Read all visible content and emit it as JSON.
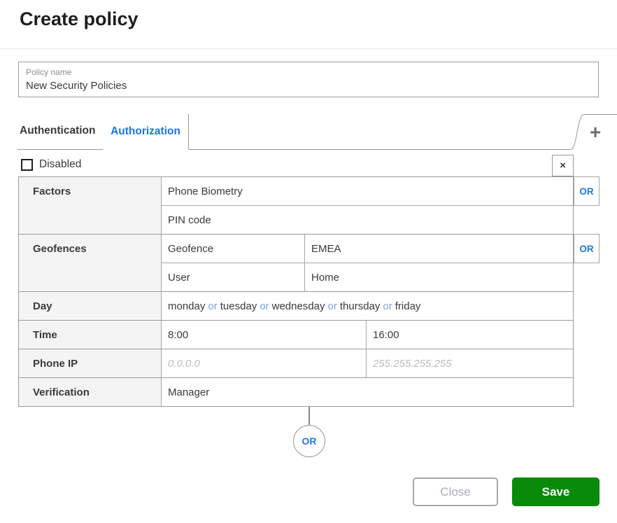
{
  "window": {
    "title": "Create policy"
  },
  "policy_name": {
    "label": "Policy name",
    "value": "New Security Policies"
  },
  "tabs": {
    "items": [
      {
        "label": "Authentication",
        "active": false
      },
      {
        "label": "Authorization",
        "active": true
      }
    ],
    "add_button": "+"
  },
  "panel": {
    "disabled_label": "Disabled",
    "disabled_checked": false,
    "remove_icon": "×"
  },
  "rules": [
    {
      "label": "Factors",
      "rows": [
        {
          "cells": [
            "Phone Biometry"
          ],
          "or": "OR"
        },
        {
          "cells": [
            "PIN code"
          ]
        }
      ]
    },
    {
      "label": "Geofences",
      "rows": [
        {
          "cells": [
            "Geofence",
            "EMEA"
          ],
          "or": "OR"
        },
        {
          "cells": [
            "User",
            "Home"
          ]
        }
      ]
    },
    {
      "label": "Day",
      "rows": [
        {
          "days": [
            "monday",
            "tuesday",
            "wednesday",
            "thursday",
            "friday"
          ],
          "joiner": "or"
        }
      ]
    },
    {
      "label": "Time",
      "rows": [
        {
          "cells": [
            "8:00",
            "16:00"
          ]
        }
      ]
    },
    {
      "label": "Phone IP",
      "rows": [
        {
          "placeholders": [
            "0.0.0.0",
            "255.255.255.255"
          ]
        }
      ]
    },
    {
      "label": "Verification",
      "rows": [
        {
          "cells": [
            "Manager"
          ]
        }
      ]
    }
  ],
  "connector": {
    "label": "OR"
  },
  "footer": {
    "close_label": "Close",
    "save_label": "Save"
  },
  "colors": {
    "accent_blue": "#1b75e8",
    "joiner_blue": "#7ba7e3",
    "save_green": "#0a8a0a",
    "border_gray": "#9a9a9a",
    "label_bg": "#f4f4f4"
  }
}
